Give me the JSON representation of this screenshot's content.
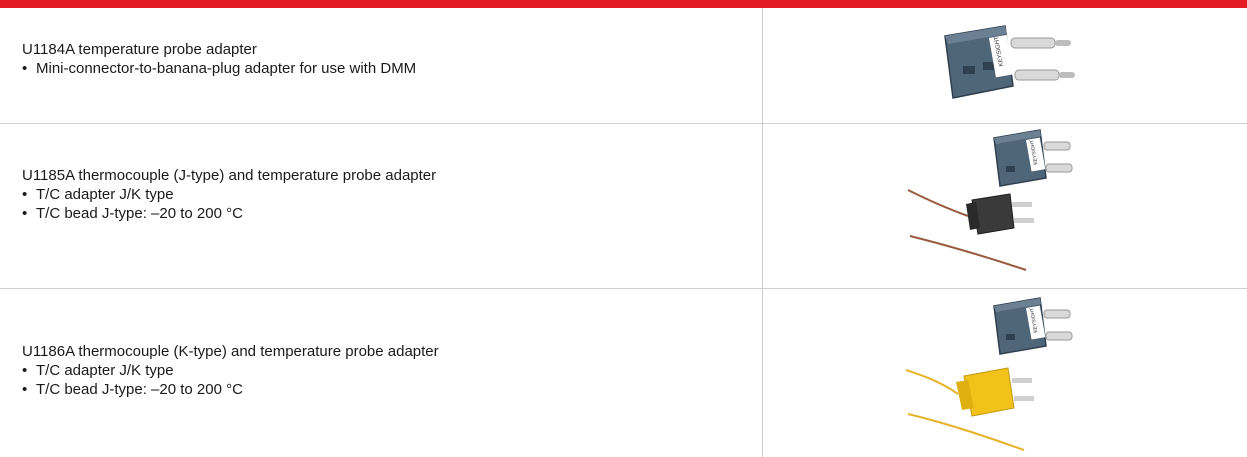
{
  "rows": [
    {
      "title": "U1184A temperature probe adapter",
      "bullets": [
        "Mini-connector-to-banana-plug adapter for use with DMM"
      ],
      "image": "banana-adapter-image",
      "brand": "KEYSIGHT"
    },
    {
      "title": "U1185A thermocouple (J-type) and temperature probe adapter",
      "bullets": [
        "T/C adapter J/K type",
        "T/C bead J-type: –20 to 200 °C"
      ],
      "image": "j-type-thermocouple-image",
      "brand": "KEYSIGHT"
    },
    {
      "title": "U1186A thermocouple (K-type) and temperature probe adapter",
      "bullets": [
        "T/C adapter J/K type",
        "T/C bead J-type: –20 to 200 °C"
      ],
      "image": "k-type-thermocouple-image",
      "brand": "KEYSIGHT"
    }
  ],
  "colors": {
    "accent_bar": "#e31b23",
    "adapter_body": "#4f6678",
    "j_plug": "#3a3a3a",
    "k_plug": "#f2c21a",
    "j_wire": "#9a5a3e",
    "k_wire": "#e6b32a"
  }
}
